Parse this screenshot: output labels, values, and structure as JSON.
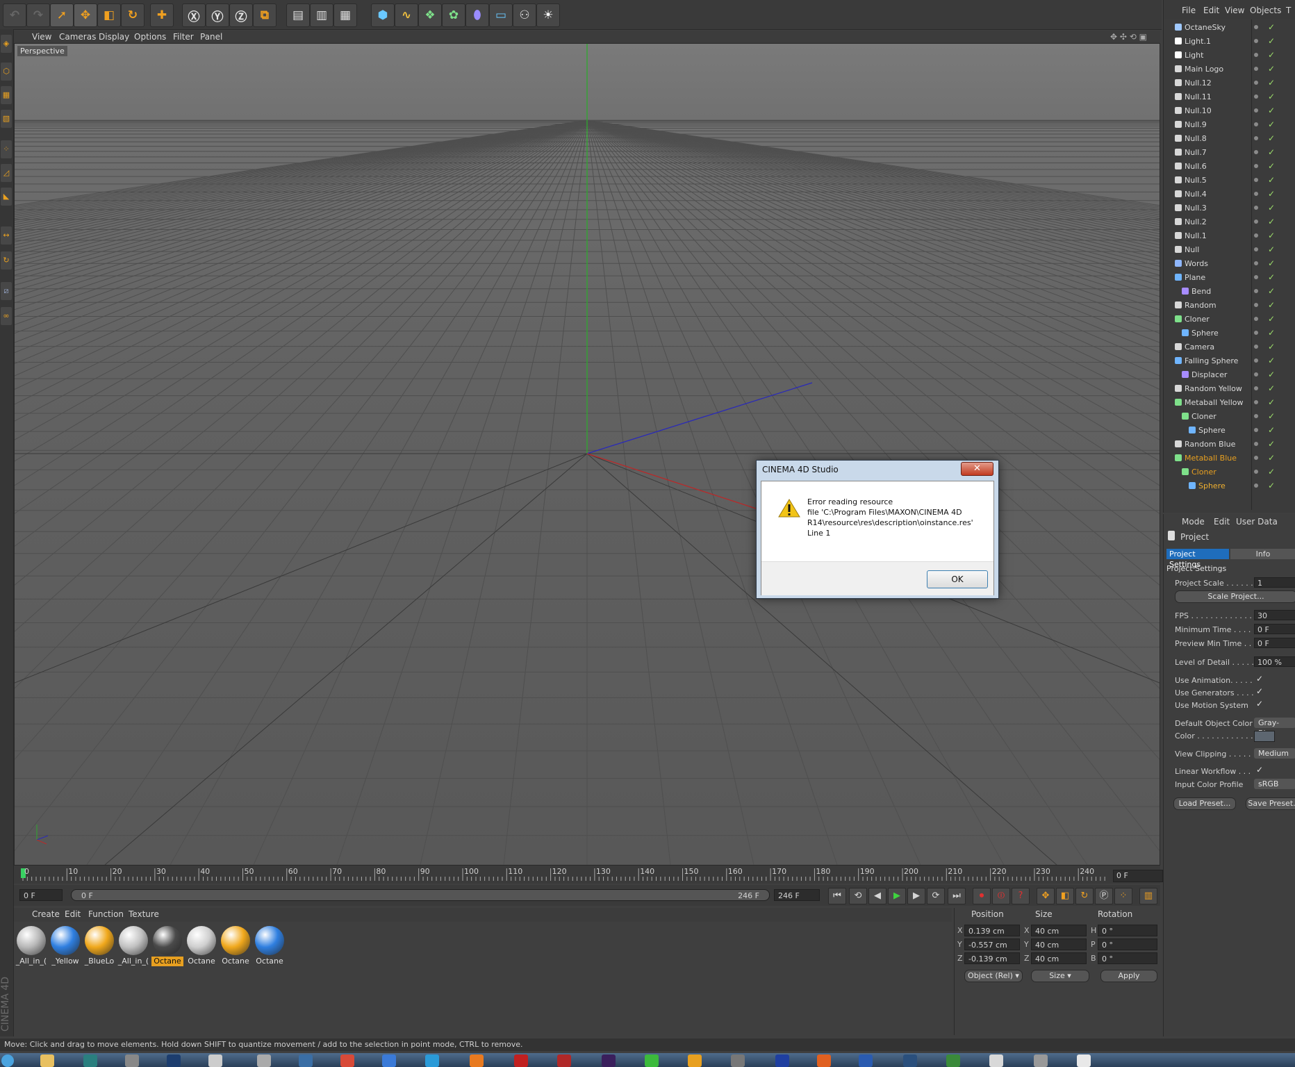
{
  "viewport": {
    "menu": [
      "View",
      "Cameras",
      "Display",
      "Options",
      "Filter",
      "Panel"
    ],
    "label": "Perspective"
  },
  "timeline": {
    "ticks": [
      "0",
      "10",
      "20",
      "30",
      "40",
      "50",
      "60",
      "70",
      "80",
      "90",
      "100",
      "110",
      "120",
      "130",
      "140",
      "150",
      "160",
      "170",
      "180",
      "190",
      "200",
      "210",
      "220",
      "230",
      "240"
    ],
    "current_frame": "0 F",
    "start": "0 F",
    "range_start": "0 F",
    "range_end": "246 F",
    "end": "246 F"
  },
  "material_manager": {
    "menu": [
      "Create",
      "Edit",
      "Function",
      "Texture"
    ],
    "materials": [
      {
        "label": "_All_in_(",
        "color": "#b8b8b8"
      },
      {
        "label": "_Yellow",
        "color": "#2f7fe0"
      },
      {
        "label": "_BlueLo",
        "color": "#f0a81c"
      },
      {
        "label": "_All_in_(",
        "color": "#c2c2c2"
      },
      {
        "label": "Octane",
        "color": "#4a4a4a",
        "selected": true
      },
      {
        "label": "Octane",
        "color": "#cfcfcf"
      },
      {
        "label": "Octane",
        "color": "#f0a81c"
      },
      {
        "label": "Octane",
        "color": "#2f7fe0"
      }
    ]
  },
  "coordinates": {
    "headers": [
      "Position",
      "Size",
      "Rotation"
    ],
    "rows": [
      {
        "axis": "X",
        "pos": "0.139 cm",
        "size_axis": "X",
        "size": "40 cm",
        "rot_axis": "H",
        "rot": "0 °"
      },
      {
        "axis": "Y",
        "pos": "-0.557 cm",
        "size_axis": "Y",
        "size": "40 cm",
        "rot_axis": "P",
        "rot": "0 °"
      },
      {
        "axis": "Z",
        "pos": "-0.139 cm",
        "size_axis": "Z",
        "size": "40 cm",
        "rot_axis": "B",
        "rot": "0 °"
      }
    ],
    "mode": "Object (Rel)",
    "size_mode": "Size",
    "apply": "Apply"
  },
  "status_text": "Move: Click and drag to move elements. Hold down SHIFT to quantize movement / add to the selection in point mode, CTRL to remove.",
  "object_manager": {
    "menu": [
      "File",
      "Edit",
      "View",
      "Objects",
      "T"
    ],
    "objects": [
      {
        "name": "OctaneSky",
        "depth": 0,
        "icon": "sky-icon",
        "color": "#9fc8ff"
      },
      {
        "name": "Light.1",
        "depth": 0,
        "icon": "light-icon",
        "color": "#ffffff"
      },
      {
        "name": "Light",
        "depth": 0,
        "icon": "light-icon",
        "color": "#ffffff"
      },
      {
        "name": "Main Logo",
        "depth": 0,
        "icon": "null-icon",
        "color": "#d8d8d8"
      },
      {
        "name": "Null.12",
        "depth": 0,
        "icon": "null-icon",
        "color": "#d8d8d8"
      },
      {
        "name": "Null.11",
        "depth": 0,
        "icon": "null-icon",
        "color": "#d8d8d8"
      },
      {
        "name": "Null.10",
        "depth": 0,
        "icon": "null-icon",
        "color": "#d8d8d8"
      },
      {
        "name": "Null.9",
        "depth": 0,
        "icon": "null-icon",
        "color": "#d8d8d8"
      },
      {
        "name": "Null.8",
        "depth": 0,
        "icon": "null-icon",
        "color": "#d8d8d8"
      },
      {
        "name": "Null.7",
        "depth": 0,
        "icon": "null-icon",
        "color": "#d8d8d8"
      },
      {
        "name": "Null.6",
        "depth": 0,
        "icon": "null-icon",
        "color": "#d8d8d8"
      },
      {
        "name": "Null.5",
        "depth": 0,
        "icon": "null-icon",
        "color": "#d8d8d8"
      },
      {
        "name": "Null.4",
        "depth": 0,
        "icon": "null-icon",
        "color": "#d8d8d8"
      },
      {
        "name": "Null.3",
        "depth": 0,
        "icon": "null-icon",
        "color": "#d8d8d8"
      },
      {
        "name": "Null.2",
        "depth": 0,
        "icon": "null-icon",
        "color": "#d8d8d8"
      },
      {
        "name": "Null.1",
        "depth": 0,
        "icon": "null-icon",
        "color": "#d8d8d8"
      },
      {
        "name": "Null",
        "depth": 0,
        "icon": "null-icon",
        "color": "#d8d8d8"
      },
      {
        "name": "Words",
        "depth": 0,
        "icon": "text-icon",
        "color": "#8fb7ff"
      },
      {
        "name": "Plane",
        "depth": 0,
        "icon": "plane-icon",
        "color": "#6fb5ff"
      },
      {
        "name": "Bend",
        "depth": 1,
        "icon": "deformer-icon",
        "color": "#a78cff"
      },
      {
        "name": "Random",
        "depth": 0,
        "icon": "effector-icon",
        "color": "#d8d8d8"
      },
      {
        "name": "Cloner",
        "depth": 0,
        "icon": "cloner-icon",
        "color": "#7ee08a"
      },
      {
        "name": "Sphere",
        "depth": 1,
        "icon": "sphere-icon",
        "color": "#6fb5ff"
      },
      {
        "name": "Camera",
        "depth": 0,
        "icon": "camera-icon",
        "color": "#d8d8d8"
      },
      {
        "name": "Falling Sphere",
        "depth": 0,
        "icon": "sphere-icon",
        "color": "#6fb5ff"
      },
      {
        "name": "Displacer",
        "depth": 1,
        "icon": "deformer-icon",
        "color": "#a78cff"
      },
      {
        "name": "Random Yellow",
        "depth": 0,
        "icon": "effector-icon",
        "color": "#d8d8d8"
      },
      {
        "name": "Metaball Yellow",
        "depth": 0,
        "icon": "metaball-icon",
        "color": "#7ee08a"
      },
      {
        "name": "Cloner",
        "depth": 1,
        "icon": "cloner-icon",
        "color": "#7ee08a"
      },
      {
        "name": "Sphere",
        "depth": 2,
        "icon": "sphere-icon",
        "color": "#6fb5ff"
      },
      {
        "name": "Random Blue",
        "depth": 0,
        "icon": "effector-icon",
        "color": "#d8d8d8"
      },
      {
        "name": "Metaball Blue",
        "depth": 0,
        "icon": "metaball-icon",
        "color": "#7ee08a",
        "highlight": "#e8a020"
      },
      {
        "name": "Cloner",
        "depth": 1,
        "icon": "cloner-icon",
        "color": "#7ee08a",
        "highlight": "#e8a020"
      },
      {
        "name": "Sphere",
        "depth": 2,
        "icon": "sphere-icon",
        "color": "#6fb5ff",
        "highlight": "#f0b030"
      }
    ]
  },
  "attribute_manager": {
    "menu": [
      "Mode",
      "Edit",
      "User Data"
    ],
    "title": "Project",
    "tabs": [
      "Project Settings",
      "Info"
    ],
    "section": "Project Settings",
    "project_scale_label": "Project Scale . . . . . .",
    "project_scale_value": "1",
    "scale_project_button": "Scale Project...",
    "fps_label": "FPS . . . . . . . . . . . . . .",
    "fps_value": "30",
    "min_time_label": "Minimum Time . . . . . .",
    "min_time_value": "0 F",
    "preview_min_label": "Preview Min Time . .",
    "preview_min_value": "0 F",
    "lod_label": "Level of Detail . . . . .",
    "lod_value": "100 %",
    "use_animation_label": "Use Animation. . . . .",
    "use_generators_label": "Use Generators . . . .",
    "use_motion_label": "Use Motion System",
    "default_color_label": "Default Object Color",
    "default_color_value": "Gray-Blue",
    "color_label": "Color . . . . . . . . . . . .",
    "view_clipping_label": "View Clipping . . . . .",
    "view_clipping_value": "Medium",
    "linear_workflow_label": "Linear Workflow . . .",
    "input_color_label": "Input Color Profile",
    "input_color_value": "sRGB",
    "load_preset": "Load Preset...",
    "save_preset": "Save Preset..."
  },
  "dialog": {
    "title": "CINEMA 4D Studio",
    "line1": "Error reading resource",
    "line2": "file 'C:\\Program Files\\MAXON\\CINEMA 4D",
    "line3": "R14\\resource\\res\\description\\oinstance.res'",
    "line4": "Line 1",
    "ok": "OK"
  },
  "branding": "CINEMA 4D",
  "colors": {
    "accent": "#e8a020",
    "ui_bg": "#3f3f3f"
  }
}
